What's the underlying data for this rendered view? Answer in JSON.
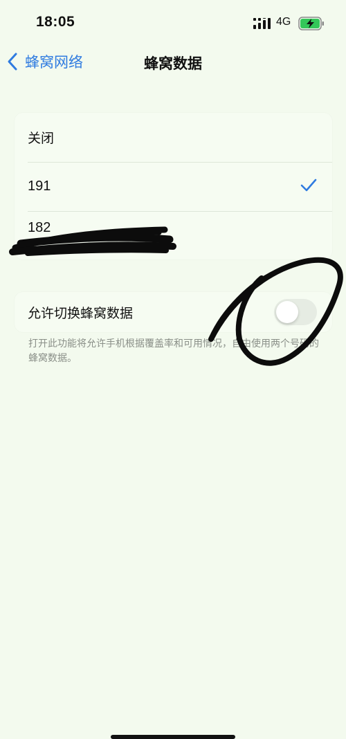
{
  "status_bar": {
    "time": "18:05",
    "network": "4G",
    "icons": [
      "signal-bars-icon",
      "battery-charging-icon"
    ],
    "battery_color": "#34c759"
  },
  "nav": {
    "back_label": "蜂窝网络",
    "title": "蜂窝数据",
    "accent_color": "#2f7be0"
  },
  "options": [
    {
      "label": "关闭",
      "selected": false
    },
    {
      "label": "191",
      "selected": true
    },
    {
      "label": "182",
      "selected": false,
      "sublabel": "···"
    }
  ],
  "toggle": {
    "label": "允许切换蜂窝数据",
    "enabled": false
  },
  "footnote": "打开此功能将允许手机根据覆盖率和可用情况，自由使用两个号码的蜂窝数据。"
}
